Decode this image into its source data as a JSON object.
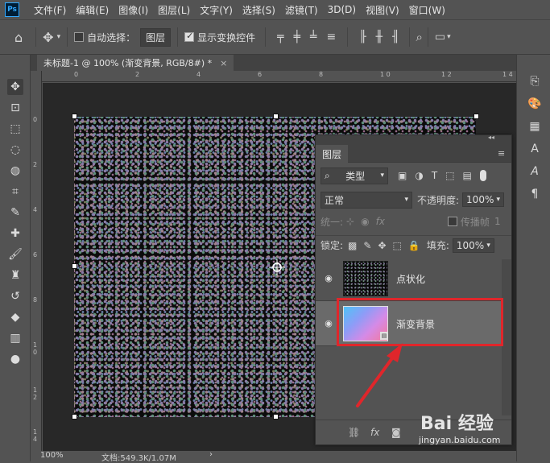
{
  "app": {
    "logo": "Ps"
  },
  "menu": [
    "文件(F)",
    "编辑(E)",
    "图像(I)",
    "图层(L)",
    "文字(Y)",
    "选择(S)",
    "滤镜(T)",
    "3D(D)",
    "视图(V)",
    "窗口(W)"
  ],
  "options": {
    "auto_select_label": "自动选择：",
    "auto_select_target": "图层",
    "show_transform_label": "显示变换控件",
    "auto_select_checked": false,
    "show_transform_checked": true
  },
  "document": {
    "tab_title": "未标题-1 @ 100% (渐变背景, RGB/8#) *",
    "tab_close": "×",
    "h_ruler": [
      "0",
      "2",
      "4",
      "6",
      "8",
      "1 0",
      "1 2",
      "1 4"
    ],
    "v_ruler": [
      "0",
      "2",
      "4",
      "6",
      "8",
      "1 0",
      "1 2",
      "1 4"
    ]
  },
  "status": {
    "zoom": "100%",
    "doc_size": "文档:549.3K/1.07M",
    "arrow": "›"
  },
  "layers_panel": {
    "tab_label": "图层",
    "filter_label": "类型",
    "blend_mode": "正常",
    "opacity_label": "不透明度:",
    "opacity_value": "100%",
    "unify_label": "统一:",
    "propagate_label": "传播帧",
    "propagate_value": "1",
    "lock_label": "锁定:",
    "fill_label": "填充:",
    "fill_value": "100%",
    "layers": [
      {
        "name": "点状化",
        "visible": true,
        "selected": false
      },
      {
        "name": "渐变背景",
        "visible": true,
        "selected": true
      }
    ],
    "bottom_icons": [
      "link-icon",
      "fx-icon",
      "mask-icon"
    ],
    "fx_label": "fx"
  },
  "watermark": {
    "brand": "Bai 经验",
    "url": "jingyan.baidu.com"
  },
  "colors": {
    "highlight": "#e0262b",
    "panel": "#535353",
    "canvas": "#0c0c0c"
  }
}
